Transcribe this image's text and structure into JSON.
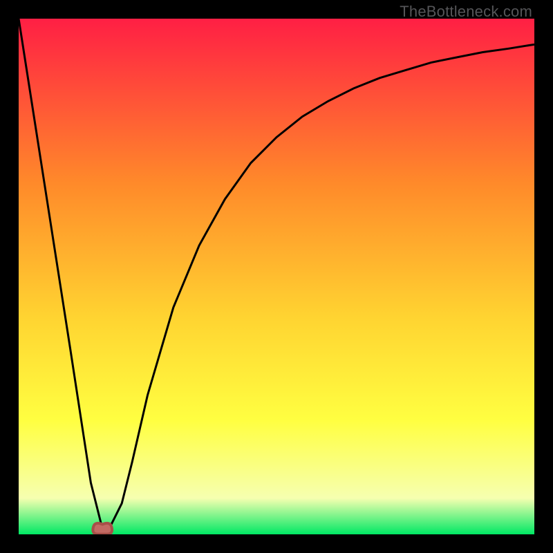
{
  "watermark": "TheBottleneck.com",
  "colors": {
    "bg": "#000000",
    "grad_top": "#ff1f44",
    "grad_mid1": "#ff8a2a",
    "grad_mid2": "#ffd431",
    "grad_mid3": "#ffff41",
    "grad_mid4": "#f6ffb0",
    "grad_bottom": "#00e864",
    "curve": "#000000",
    "marker_fill": "#c36a63",
    "marker_stroke": "#a74f48"
  },
  "chart_data": {
    "type": "line",
    "title": "",
    "xlabel": "",
    "ylabel": "",
    "xlim": [
      0,
      100
    ],
    "ylim": [
      0,
      100
    ],
    "grid": false,
    "legend": false,
    "series": [
      {
        "name": "bottleneck-curve",
        "x": [
          0,
          5,
          10,
          14,
          16,
          18,
          20,
          22,
          25,
          30,
          35,
          40,
          45,
          50,
          55,
          60,
          65,
          70,
          75,
          80,
          85,
          90,
          95,
          100
        ],
        "y": [
          100,
          68,
          36,
          10,
          2,
          2,
          6,
          14,
          27,
          44,
          56,
          65,
          72,
          77,
          81,
          84,
          86.5,
          88.5,
          90,
          91.5,
          92.5,
          93.5,
          94.2,
          95
        ]
      }
    ],
    "marker": {
      "x_range": [
        14.5,
        18
      ],
      "y": 1.5
    },
    "annotations": []
  }
}
